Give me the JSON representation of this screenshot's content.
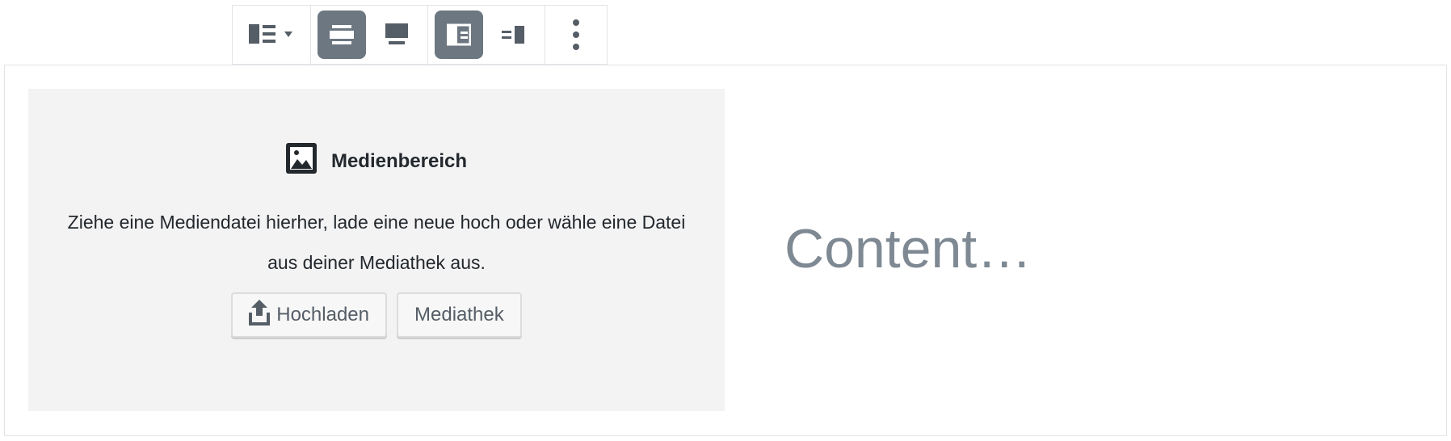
{
  "toolbar": {
    "groups": [
      {
        "buttons": [
          {
            "icon": "media-text-layout-icon",
            "has_dropdown": true
          }
        ]
      },
      {
        "buttons": [
          {
            "icon": "align-wide-icon",
            "active": true
          },
          {
            "icon": "align-full-icon",
            "active": false
          }
        ]
      },
      {
        "buttons": [
          {
            "icon": "media-left-icon",
            "active": true
          },
          {
            "icon": "media-right-icon",
            "active": false
          }
        ]
      },
      {
        "buttons": [
          {
            "icon": "more-options-icon"
          }
        ]
      }
    ]
  },
  "media_placeholder": {
    "label": "Medienbereich",
    "icon": "image-icon",
    "instructions": "Ziehe eine Mediendatei hierher, lade eine neue hoch oder wähle eine Datei aus deiner Mediathek aus.",
    "upload_label": "Hochladen",
    "upload_icon": "upload-icon",
    "library_label": "Mediathek"
  },
  "content": {
    "placeholder": "Content…"
  },
  "colors": {
    "active_button": "#6c7781",
    "placeholder_bg": "#f3f3f4",
    "text": "#23282d",
    "muted_text": "#7e8993"
  }
}
